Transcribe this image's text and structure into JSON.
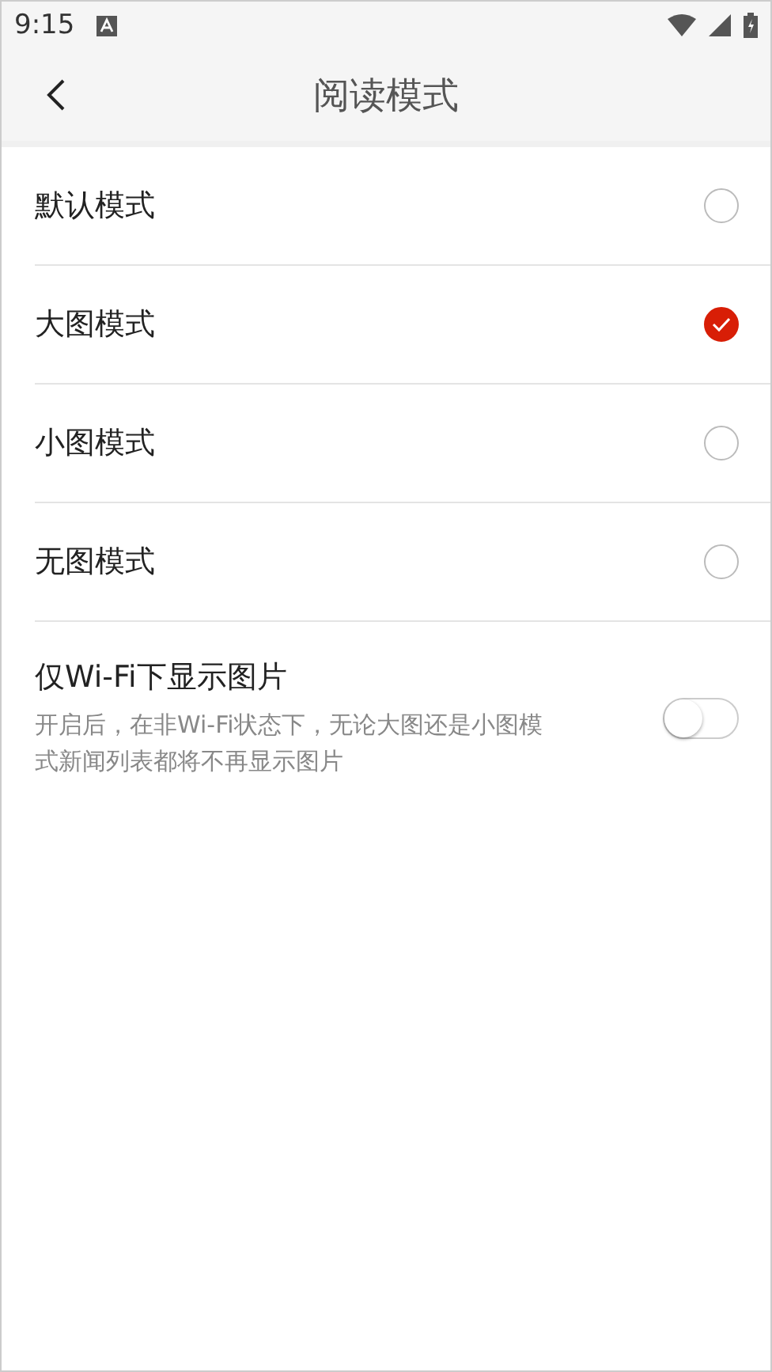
{
  "status_bar": {
    "time": "9:15"
  },
  "toolbar": {
    "title": "阅读模式"
  },
  "modes": [
    {
      "label": "默认模式",
      "selected": false
    },
    {
      "label": "大图模式",
      "selected": true
    },
    {
      "label": "小图模式",
      "selected": false
    },
    {
      "label": "无图模式",
      "selected": false
    }
  ],
  "wifi_only": {
    "title": "仅Wi-Fi下显示图片",
    "description": "开启后，在非Wi-Fi状态下，无论大图还是小图模式新闻列表都将不再显示图片",
    "on": false
  }
}
